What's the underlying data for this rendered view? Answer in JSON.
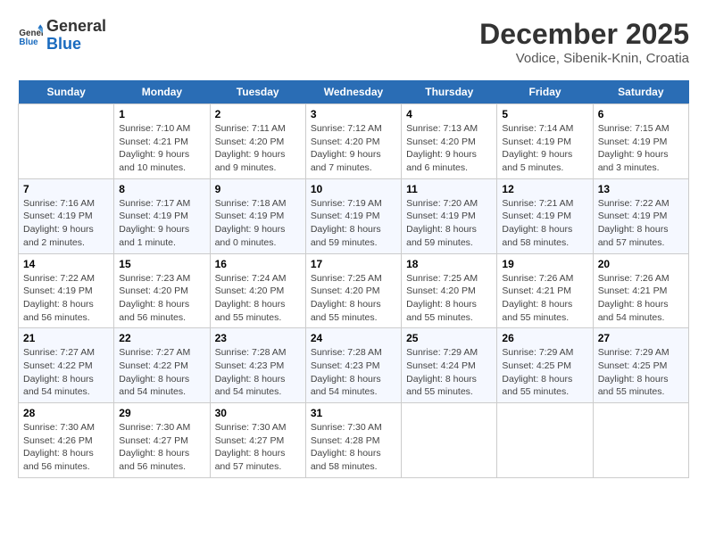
{
  "logo": {
    "general": "General",
    "blue": "Blue"
  },
  "header": {
    "month": "December 2025",
    "location": "Vodice, Sibenik-Knin, Croatia"
  },
  "weekdays": [
    "Sunday",
    "Monday",
    "Tuesday",
    "Wednesday",
    "Thursday",
    "Friday",
    "Saturday"
  ],
  "weeks": [
    [
      {
        "day": "",
        "sunrise": "",
        "sunset": "",
        "daylight": ""
      },
      {
        "day": "1",
        "sunrise": "Sunrise: 7:10 AM",
        "sunset": "Sunset: 4:21 PM",
        "daylight": "Daylight: 9 hours and 10 minutes."
      },
      {
        "day": "2",
        "sunrise": "Sunrise: 7:11 AM",
        "sunset": "Sunset: 4:20 PM",
        "daylight": "Daylight: 9 hours and 9 minutes."
      },
      {
        "day": "3",
        "sunrise": "Sunrise: 7:12 AM",
        "sunset": "Sunset: 4:20 PM",
        "daylight": "Daylight: 9 hours and 7 minutes."
      },
      {
        "day": "4",
        "sunrise": "Sunrise: 7:13 AM",
        "sunset": "Sunset: 4:20 PM",
        "daylight": "Daylight: 9 hours and 6 minutes."
      },
      {
        "day": "5",
        "sunrise": "Sunrise: 7:14 AM",
        "sunset": "Sunset: 4:19 PM",
        "daylight": "Daylight: 9 hours and 5 minutes."
      },
      {
        "day": "6",
        "sunrise": "Sunrise: 7:15 AM",
        "sunset": "Sunset: 4:19 PM",
        "daylight": "Daylight: 9 hours and 3 minutes."
      }
    ],
    [
      {
        "day": "7",
        "sunrise": "Sunrise: 7:16 AM",
        "sunset": "Sunset: 4:19 PM",
        "daylight": "Daylight: 9 hours and 2 minutes."
      },
      {
        "day": "8",
        "sunrise": "Sunrise: 7:17 AM",
        "sunset": "Sunset: 4:19 PM",
        "daylight": "Daylight: 9 hours and 1 minute."
      },
      {
        "day": "9",
        "sunrise": "Sunrise: 7:18 AM",
        "sunset": "Sunset: 4:19 PM",
        "daylight": "Daylight: 9 hours and 0 minutes."
      },
      {
        "day": "10",
        "sunrise": "Sunrise: 7:19 AM",
        "sunset": "Sunset: 4:19 PM",
        "daylight": "Daylight: 8 hours and 59 minutes."
      },
      {
        "day": "11",
        "sunrise": "Sunrise: 7:20 AM",
        "sunset": "Sunset: 4:19 PM",
        "daylight": "Daylight: 8 hours and 59 minutes."
      },
      {
        "day": "12",
        "sunrise": "Sunrise: 7:21 AM",
        "sunset": "Sunset: 4:19 PM",
        "daylight": "Daylight: 8 hours and 58 minutes."
      },
      {
        "day": "13",
        "sunrise": "Sunrise: 7:22 AM",
        "sunset": "Sunset: 4:19 PM",
        "daylight": "Daylight: 8 hours and 57 minutes."
      }
    ],
    [
      {
        "day": "14",
        "sunrise": "Sunrise: 7:22 AM",
        "sunset": "Sunset: 4:19 PM",
        "daylight": "Daylight: 8 hours and 56 minutes."
      },
      {
        "day": "15",
        "sunrise": "Sunrise: 7:23 AM",
        "sunset": "Sunset: 4:20 PM",
        "daylight": "Daylight: 8 hours and 56 minutes."
      },
      {
        "day": "16",
        "sunrise": "Sunrise: 7:24 AM",
        "sunset": "Sunset: 4:20 PM",
        "daylight": "Daylight: 8 hours and 55 minutes."
      },
      {
        "day": "17",
        "sunrise": "Sunrise: 7:25 AM",
        "sunset": "Sunset: 4:20 PM",
        "daylight": "Daylight: 8 hours and 55 minutes."
      },
      {
        "day": "18",
        "sunrise": "Sunrise: 7:25 AM",
        "sunset": "Sunset: 4:20 PM",
        "daylight": "Daylight: 8 hours and 55 minutes."
      },
      {
        "day": "19",
        "sunrise": "Sunrise: 7:26 AM",
        "sunset": "Sunset: 4:21 PM",
        "daylight": "Daylight: 8 hours and 55 minutes."
      },
      {
        "day": "20",
        "sunrise": "Sunrise: 7:26 AM",
        "sunset": "Sunset: 4:21 PM",
        "daylight": "Daylight: 8 hours and 54 minutes."
      }
    ],
    [
      {
        "day": "21",
        "sunrise": "Sunrise: 7:27 AM",
        "sunset": "Sunset: 4:22 PM",
        "daylight": "Daylight: 8 hours and 54 minutes."
      },
      {
        "day": "22",
        "sunrise": "Sunrise: 7:27 AM",
        "sunset": "Sunset: 4:22 PM",
        "daylight": "Daylight: 8 hours and 54 minutes."
      },
      {
        "day": "23",
        "sunrise": "Sunrise: 7:28 AM",
        "sunset": "Sunset: 4:23 PM",
        "daylight": "Daylight: 8 hours and 54 minutes."
      },
      {
        "day": "24",
        "sunrise": "Sunrise: 7:28 AM",
        "sunset": "Sunset: 4:23 PM",
        "daylight": "Daylight: 8 hours and 54 minutes."
      },
      {
        "day": "25",
        "sunrise": "Sunrise: 7:29 AM",
        "sunset": "Sunset: 4:24 PM",
        "daylight": "Daylight: 8 hours and 55 minutes."
      },
      {
        "day": "26",
        "sunrise": "Sunrise: 7:29 AM",
        "sunset": "Sunset: 4:25 PM",
        "daylight": "Daylight: 8 hours and 55 minutes."
      },
      {
        "day": "27",
        "sunrise": "Sunrise: 7:29 AM",
        "sunset": "Sunset: 4:25 PM",
        "daylight": "Daylight: 8 hours and 55 minutes."
      }
    ],
    [
      {
        "day": "28",
        "sunrise": "Sunrise: 7:30 AM",
        "sunset": "Sunset: 4:26 PM",
        "daylight": "Daylight: 8 hours and 56 minutes."
      },
      {
        "day": "29",
        "sunrise": "Sunrise: 7:30 AM",
        "sunset": "Sunset: 4:27 PM",
        "daylight": "Daylight: 8 hours and 56 minutes."
      },
      {
        "day": "30",
        "sunrise": "Sunrise: 7:30 AM",
        "sunset": "Sunset: 4:27 PM",
        "daylight": "Daylight: 8 hours and 57 minutes."
      },
      {
        "day": "31",
        "sunrise": "Sunrise: 7:30 AM",
        "sunset": "Sunset: 4:28 PM",
        "daylight": "Daylight: 8 hours and 58 minutes."
      },
      {
        "day": "",
        "sunrise": "",
        "sunset": "",
        "daylight": ""
      },
      {
        "day": "",
        "sunrise": "",
        "sunset": "",
        "daylight": ""
      },
      {
        "day": "",
        "sunrise": "",
        "sunset": "",
        "daylight": ""
      }
    ]
  ]
}
